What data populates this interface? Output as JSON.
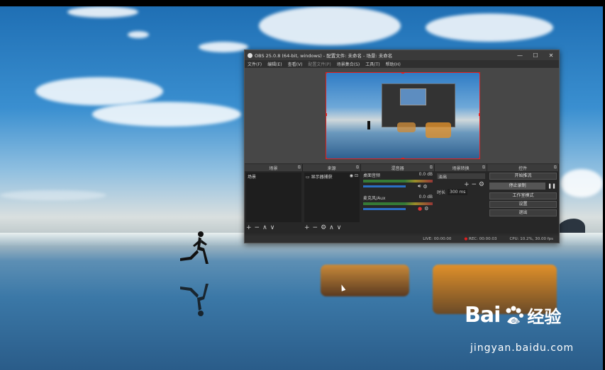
{
  "window": {
    "title": "OBS 25.0.8 (64-bit, windows) - 配置文件: 未命名 - 场景: 未命名",
    "minimize": "—",
    "maximize": "☐",
    "close": "✕"
  },
  "menu": [
    "文件(F)",
    "编辑(E)",
    "查看(V)",
    "配置文件(P)",
    "场景集合(S)",
    "工具(T)",
    "帮助(H)"
  ],
  "docks": {
    "scenes": "场景",
    "sources": "来源",
    "mixer": "混音器",
    "transitions": "场景转换",
    "controls": "控件"
  },
  "scenes_panel": {
    "items": [
      "场景"
    ]
  },
  "sources_panel": {
    "items": [
      "显示器捕获"
    ]
  },
  "mixer_panel": {
    "channels": [
      {
        "name": "桌面音频",
        "db": "0.0 dB"
      },
      {
        "name": "麦克风/Aux",
        "db": "0.0 dB"
      }
    ]
  },
  "transitions_panel": {
    "type": "淡出",
    "duration_label": "时长",
    "duration_value": "300 ms"
  },
  "controls_panel": {
    "buttons": [
      "开始推流",
      "停止录制",
      "工作室模式",
      "设置",
      "退出"
    ]
  },
  "statusbar": {
    "live": "LIVE: 00:00:00",
    "rec": "REC: 00:00:03",
    "cpu": "CPU: 10.2%, 30.00 fps"
  },
  "watermark": {
    "brand": "Bai",
    "brand_cn": "经验",
    "url": "jingyan.baidu.com"
  },
  "colors": {
    "selection_red": "#e02020",
    "obs_bg": "#2b2b2b",
    "accent_blue": "#2a6fc7"
  }
}
